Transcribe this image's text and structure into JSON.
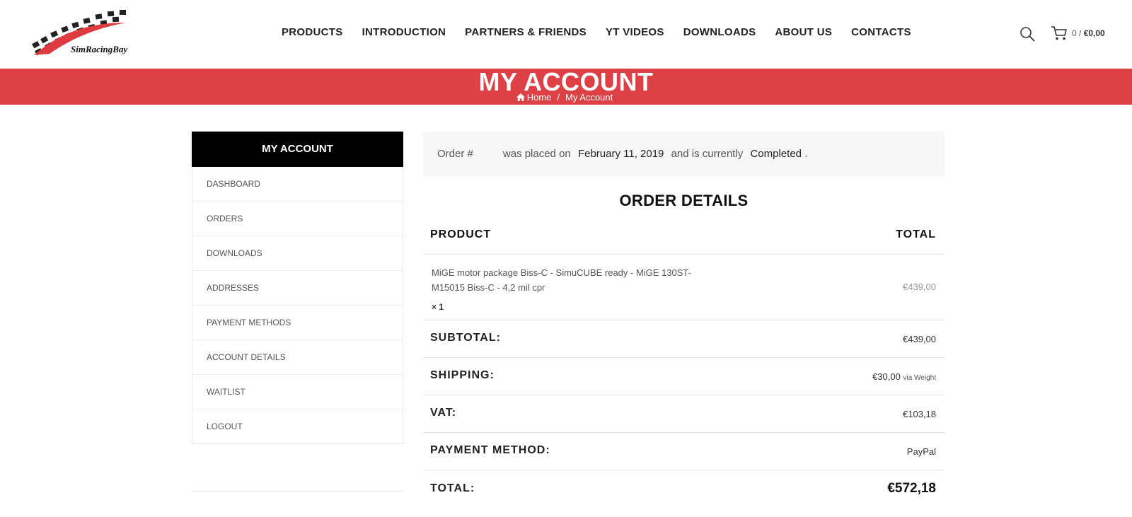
{
  "brand": {
    "logo_text": "SimRacingBay"
  },
  "nav": [
    "PRODUCTS",
    "INTRODUCTION",
    "PARTNERS & FRIENDS",
    "YT VIDEOS",
    "DOWNLOADS",
    "ABOUT US",
    "CONTACTS"
  ],
  "cart": {
    "count": "0",
    "separator": " / ",
    "amount": "€0,00"
  },
  "banner": {
    "title": "MY ACCOUNT",
    "crumb_home": "Home",
    "crumb_sep": "/",
    "crumb_current": "My Account"
  },
  "sidebar": {
    "title": "MY ACCOUNT",
    "items": [
      "DASHBOARD",
      "ORDERS",
      "DOWNLOADS",
      "ADDRESSES",
      "PAYMENT METHODS",
      "ACCOUNT DETAILS",
      "WAITLIST",
      "LOGOUT"
    ]
  },
  "notice": {
    "order_label": "Order #",
    "placed_text": "was placed on",
    "date": "February 11, 2019",
    "status_text": "and is currently",
    "status": "Completed",
    "end": "."
  },
  "order": {
    "title": "ORDER DETAILS",
    "col_product": "PRODUCT",
    "col_total": "TOTAL",
    "item": {
      "name": "MiGE motor package Biss-C - SimuCUBE ready - MiGE 130ST-M15015 Biss-C - 4,2 mil cpr",
      "qty": "× 1",
      "total": "€439,00"
    },
    "subtotal_label": "SUBTOTAL:",
    "subtotal": "€439,00",
    "shipping_label": "SHIPPING:",
    "shipping": "€30,00",
    "shipping_via": "via Weight",
    "vat_label": "VAT:",
    "vat": "€103,18",
    "payment_label": "PAYMENT METHOD:",
    "payment": "PayPal",
    "total_label": "TOTAL:",
    "total": "€572,18"
  },
  "colors": {
    "accent": "#dd4145",
    "sidebar_header": "#000000"
  }
}
